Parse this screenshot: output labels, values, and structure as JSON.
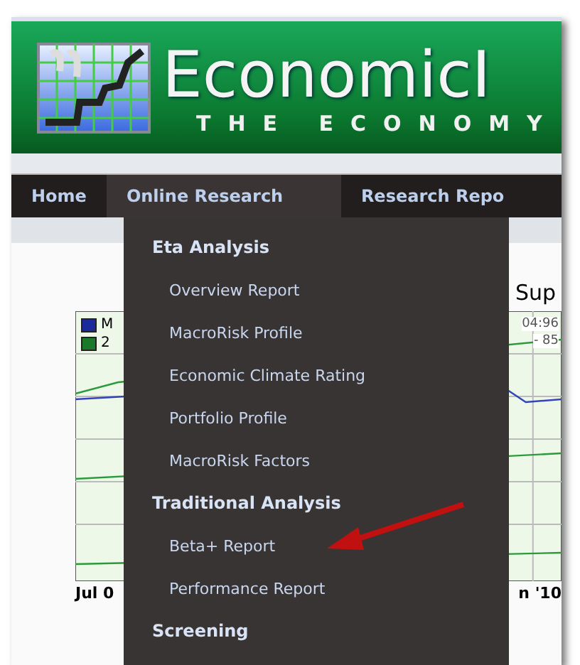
{
  "header": {
    "title": "EconomicI",
    "tagline": "THE ECONOMY"
  },
  "nav": [
    {
      "label": "Home",
      "selected": false
    },
    {
      "label": "Online Research",
      "selected": true
    },
    {
      "label": "Research Repo",
      "selected": false
    }
  ],
  "chart": {
    "title": "Sup",
    "legend": [
      "M",
      "2"
    ],
    "readings": [
      "04:96",
      "- 85"
    ],
    "x_labels": [
      "Jul 0",
      "n '10"
    ]
  },
  "menu": [
    {
      "kind": "heading",
      "label": "Eta Analysis"
    },
    {
      "kind": "link",
      "label": "Overview Report"
    },
    {
      "kind": "link",
      "label": "MacroRisk Profile"
    },
    {
      "kind": "link",
      "label": "Economic Climate Rating"
    },
    {
      "kind": "link",
      "label": "Portfolio Profile"
    },
    {
      "kind": "link",
      "label": "MacroRisk Factors"
    },
    {
      "kind": "heading",
      "label": "Traditional Analysis"
    },
    {
      "kind": "link",
      "label": "Beta+ Report"
    },
    {
      "kind": "link",
      "label": "Performance Report"
    },
    {
      "kind": "heading",
      "label": "Screening"
    }
  ]
}
